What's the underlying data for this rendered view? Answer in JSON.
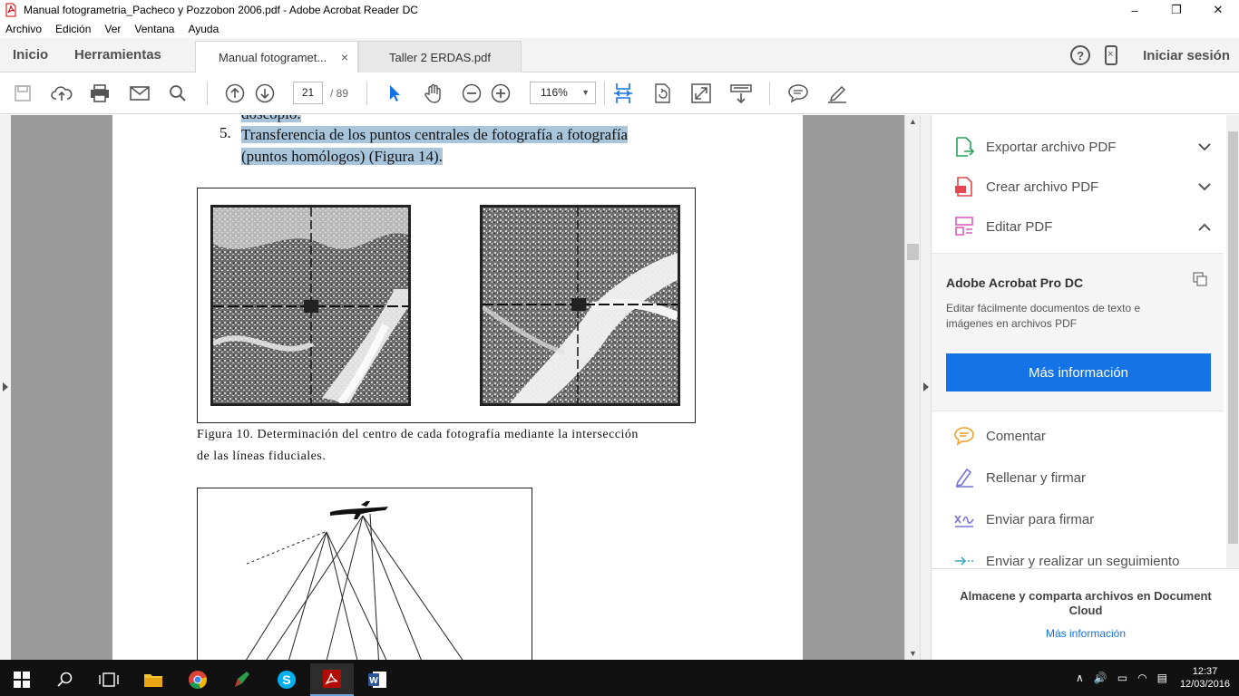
{
  "window": {
    "title": "Manual fotogrametria_Pacheco y Pozzobon 2006.pdf - Adobe Acrobat Reader DC",
    "minimize": "–",
    "restore": "❐",
    "close": "✕"
  },
  "menu": [
    "Archivo",
    "Edición",
    "Ver",
    "Ventana",
    "Ayuda"
  ],
  "nav": {
    "home": "Inicio",
    "tools": "Herramientas",
    "signin": "Iniciar sesión",
    "help": "?"
  },
  "tabs": [
    {
      "label": "Manual fotogramet...",
      "close": "×",
      "active": true
    },
    {
      "label": "Taller 2 ERDAS.pdf",
      "active": false
    }
  ],
  "toolbar": {
    "page_current": "21",
    "page_total": "/ 89",
    "zoom": "116%",
    "icons": [
      "save-icon",
      "upload-icon",
      "print-icon",
      "email-icon",
      "search-icon",
      "page-up-icon",
      "page-down-icon",
      "select-arrow-icon",
      "hand-icon",
      "zoom-out-icon",
      "zoom-in-icon",
      "fit-page-icon",
      "rotate-icon",
      "full-screen-icon",
      "scroll-mode-icon",
      "comment-icon",
      "highlight-icon"
    ]
  },
  "document": {
    "prev_line_fragment": "doscopio.",
    "item_number": "5.",
    "item_text_line1": "Transferencia de los puntos centrales de fotografía a fotografía",
    "item_text_line2": "(puntos homólogos) (Figura 14).",
    "figure_caption_line1": "Figura 10. Determinación del centro de cada fotografía mediante la intersección",
    "figure_caption_line2": "de las líneas fiduciales."
  },
  "right_pane": {
    "items": [
      {
        "label": "Exportar archivo PDF",
        "icon": "export-pdf-icon",
        "chevron": "down"
      },
      {
        "label": "Crear archivo PDF",
        "icon": "create-pdf-icon",
        "chevron": "down"
      },
      {
        "label": "Editar PDF",
        "icon": "edit-pdf-icon",
        "chevron": "up"
      }
    ],
    "promo": {
      "title": "Adobe Acrobat Pro DC",
      "description": "Editar fácilmente documentos de texto e imágenes en archivos PDF",
      "button": "Más información"
    },
    "tools": [
      {
        "label": "Comentar",
        "icon": "comment-bubble-icon"
      },
      {
        "label": "Rellenar y firmar",
        "icon": "fill-sign-icon"
      },
      {
        "label": "Enviar para firmar",
        "icon": "send-sign-icon"
      },
      {
        "label": "Enviar y realizar un seguimiento",
        "icon": "send-track-icon"
      }
    ],
    "bottom_text": "Almacene y comparta archivos en Document Cloud",
    "bottom_link": "Más información"
  },
  "taskbar": {
    "apps": [
      "windows-start-icon",
      "search-icon",
      "task-view-icon",
      "file-explorer-icon",
      "chrome-icon",
      "pen-tool-icon",
      "skype-icon",
      "acrobat-icon",
      "word-icon"
    ],
    "time": "12:37",
    "date": "12/03/2016"
  },
  "colors": {
    "accent_blue": "#1473e6",
    "highlight": "#a9c5dc",
    "doc_background": "#9a9a9a",
    "taskbar": "#111111"
  }
}
